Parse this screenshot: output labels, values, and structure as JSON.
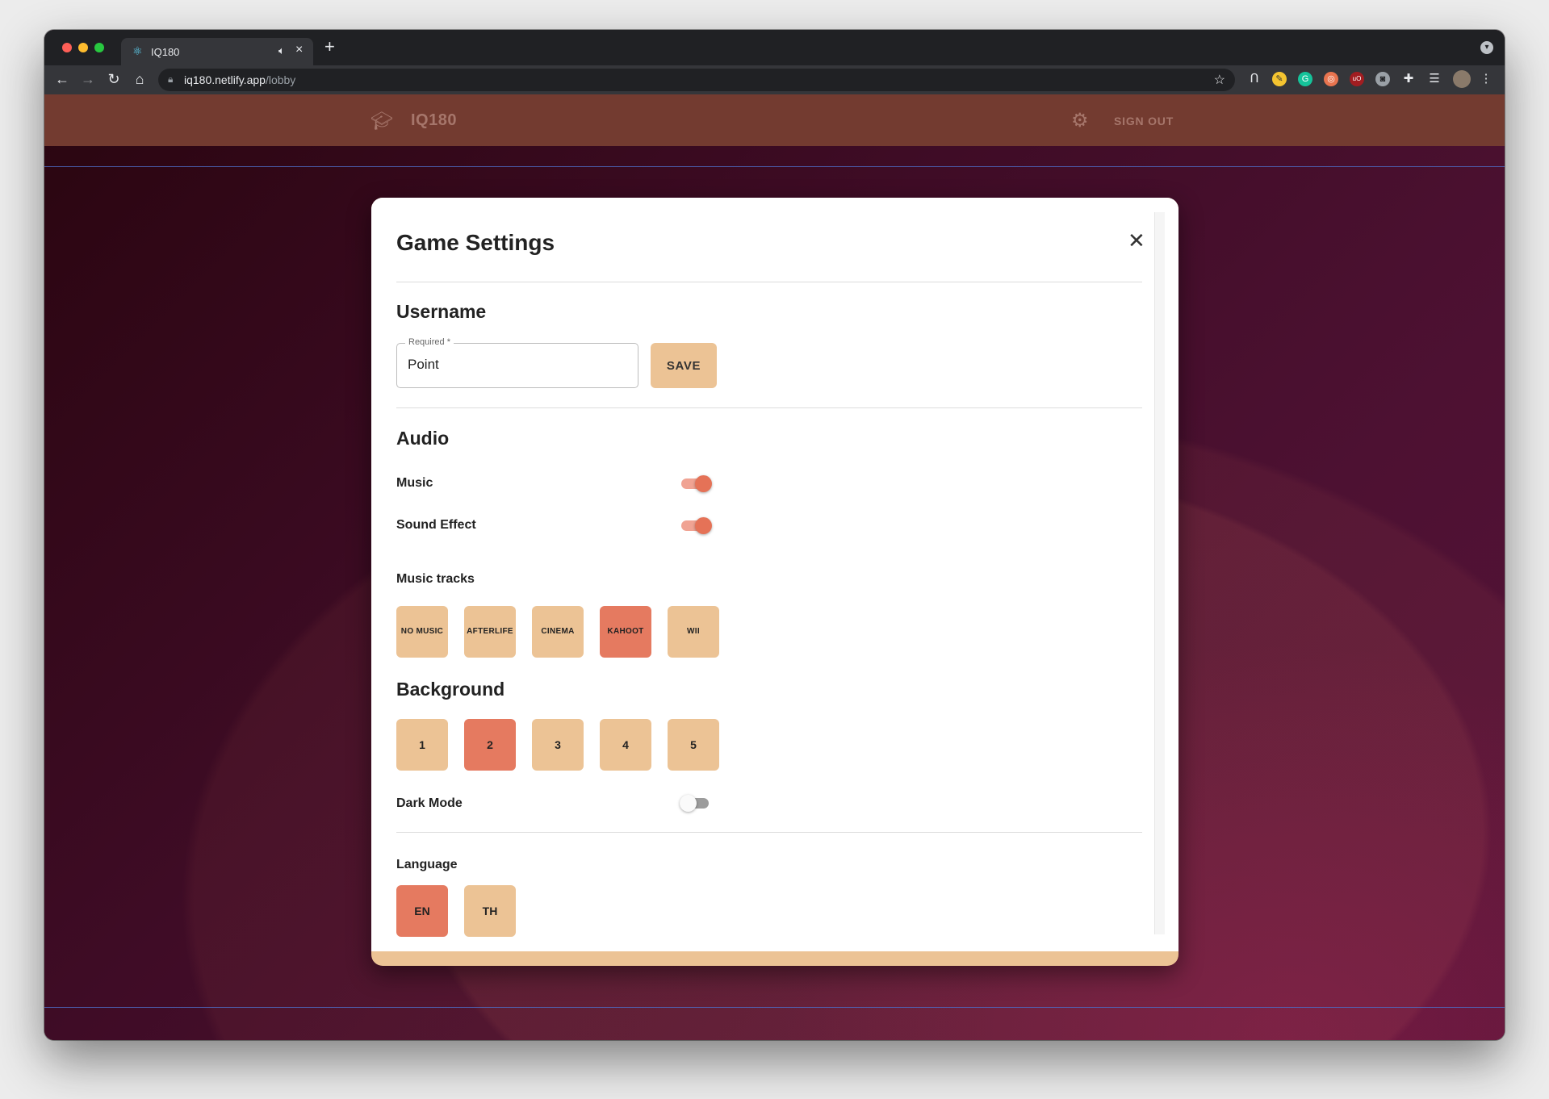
{
  "browser": {
    "tab_title": "IQ180",
    "tab_favicon": "react-icon",
    "url_host": "iq180.netlify.app",
    "url_path": "/lobby"
  },
  "app": {
    "brand": "IQ180",
    "sign_out": "SIGN OUT"
  },
  "dialog": {
    "title": "Game Settings",
    "username": {
      "heading": "Username",
      "field_label": "Required *",
      "value": "Point",
      "save_label": "SAVE"
    },
    "audio": {
      "heading": "Audio",
      "music_label": "Music",
      "music_on": true,
      "sound_label": "Sound Effect",
      "sound_on": true,
      "tracks_label": "Music tracks",
      "tracks": [
        {
          "label": "NO MUSIC",
          "selected": false
        },
        {
          "label": "AFTERLIFE",
          "selected": false
        },
        {
          "label": "CINEMA",
          "selected": false
        },
        {
          "label": "KAHOOT",
          "selected": true
        },
        {
          "label": "WII",
          "selected": false
        }
      ]
    },
    "background": {
      "heading": "Background",
      "options": [
        {
          "label": "1",
          "selected": false
        },
        {
          "label": "2",
          "selected": true
        },
        {
          "label": "3",
          "selected": false
        },
        {
          "label": "4",
          "selected": false
        },
        {
          "label": "5",
          "selected": false
        }
      ],
      "dark_mode_label": "Dark Mode",
      "dark_mode_on": false
    },
    "language": {
      "heading": "Language",
      "options": [
        {
          "label": "EN",
          "selected": true
        },
        {
          "label": "TH",
          "selected": false
        }
      ]
    }
  },
  "colors": {
    "appbar": "#733b30",
    "accent_tile": "#ecc395",
    "selected_tile": "#e57a60",
    "switch_on": "#e57257"
  }
}
